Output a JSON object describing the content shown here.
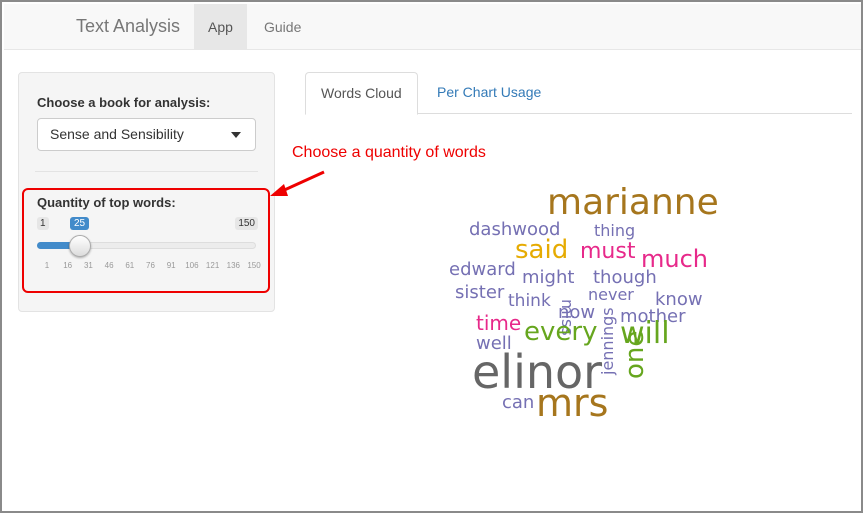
{
  "navbar": {
    "brand": "Text Analysis",
    "items": [
      {
        "label": "App"
      },
      {
        "label": "Guide"
      }
    ]
  },
  "sidebar": {
    "book_label": "Choose a book for analysis:",
    "book_value": "Sense and Sensibility",
    "quantity_label": "Quantity of top words:",
    "slider": {
      "min": "1",
      "max": "150",
      "value": "25",
      "ticks": [
        "1",
        "16",
        "31",
        "46",
        "61",
        "76",
        "91",
        "106",
        "121",
        "136",
        "150"
      ]
    }
  },
  "annotation": {
    "text": "Choose a quantity of words",
    "color": "#e00000"
  },
  "tabs": [
    {
      "label": "Words Cloud"
    },
    {
      "label": "Per Chart Usage"
    }
  ],
  "word_cloud": [
    {
      "word": "marianne",
      "color": "#a6761d"
    },
    {
      "word": "dashwood",
      "color": "#7570b3"
    },
    {
      "word": "thing",
      "color": "#7570b3"
    },
    {
      "word": "said",
      "color": "#e6ab02"
    },
    {
      "word": "must",
      "color": "#e7298a"
    },
    {
      "word": "much",
      "color": "#e7298a"
    },
    {
      "word": "edward",
      "color": "#7570b3"
    },
    {
      "word": "might",
      "color": "#7570b3"
    },
    {
      "word": "miss",
      "color": "#7570b3"
    },
    {
      "word": "though",
      "color": "#7570b3"
    },
    {
      "word": "sister",
      "color": "#7570b3"
    },
    {
      "word": "think",
      "color": "#7570b3"
    },
    {
      "word": "never",
      "color": "#7570b3"
    },
    {
      "word": "know",
      "color": "#7570b3"
    },
    {
      "word": "now",
      "color": "#7570b3"
    },
    {
      "word": "time",
      "color": "#e7298a"
    },
    {
      "word": "every",
      "color": "#66a61e"
    },
    {
      "word": "mother",
      "color": "#7570b3"
    },
    {
      "word": "jennings",
      "color": "#7570b3"
    },
    {
      "word": "will",
      "color": "#66a61e"
    },
    {
      "word": "well",
      "color": "#7570b3"
    },
    {
      "word": "elinor",
      "color": "#666666"
    },
    {
      "word": "one",
      "color": "#66a61e"
    },
    {
      "word": "can",
      "color": "#7570b3"
    },
    {
      "word": "mrs",
      "color": "#a6761d"
    }
  ]
}
